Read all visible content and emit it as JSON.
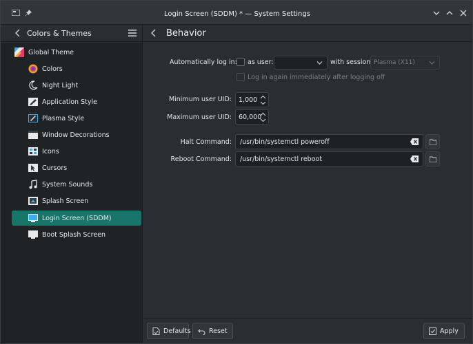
{
  "window": {
    "title": "Login Screen (SDDM) * — System Settings"
  },
  "header": {
    "category_title": "Colors & Themes",
    "page_title": "Behavior"
  },
  "sidebar": {
    "top_item": {
      "label": "Global Theme",
      "icon": "global-theme-icon"
    },
    "items": [
      {
        "label": "Colors",
        "icon": "colors-icon"
      },
      {
        "label": "Night Light",
        "icon": "night-light-icon"
      },
      {
        "label": "Application Style",
        "icon": "application-style-icon"
      },
      {
        "label": "Plasma Style",
        "icon": "plasma-style-icon"
      },
      {
        "label": "Window Decorations",
        "icon": "window-decorations-icon"
      },
      {
        "label": "Icons",
        "icon": "icons-icon"
      },
      {
        "label": "Cursors",
        "icon": "cursors-icon"
      },
      {
        "label": "System Sounds",
        "icon": "system-sounds-icon"
      },
      {
        "label": "Splash Screen",
        "icon": "splash-screen-icon"
      },
      {
        "label": "Login Screen (SDDM)",
        "icon": "login-screen-icon",
        "active": true
      },
      {
        "label": "Boot Splash Screen",
        "icon": "boot-splash-icon"
      }
    ]
  },
  "behavior": {
    "autologin_label": "Automatically log in:",
    "as_user_label": "as user:",
    "user_value": "",
    "with_session_label": "with session",
    "session_value": "Plasma (X11)",
    "relogin_label": "Log in again immediately after logging off",
    "min_uid_label": "Minimum user UID:",
    "min_uid_value": "1,000",
    "max_uid_label": "Maximum user UID:",
    "max_uid_value": "60,000",
    "halt_label": "Halt Command:",
    "halt_value": "/usr/bin/systemctl poweroff",
    "reboot_label": "Reboot Command:",
    "reboot_value": "/usr/bin/systemctl reboot"
  },
  "footer": {
    "defaults_label": "Defaults",
    "reset_label": "Reset",
    "apply_label": "Apply"
  },
  "colors": {
    "accent": "#17756a",
    "window_bg": "#2a2e32",
    "sidebar_bg": "#202326"
  }
}
